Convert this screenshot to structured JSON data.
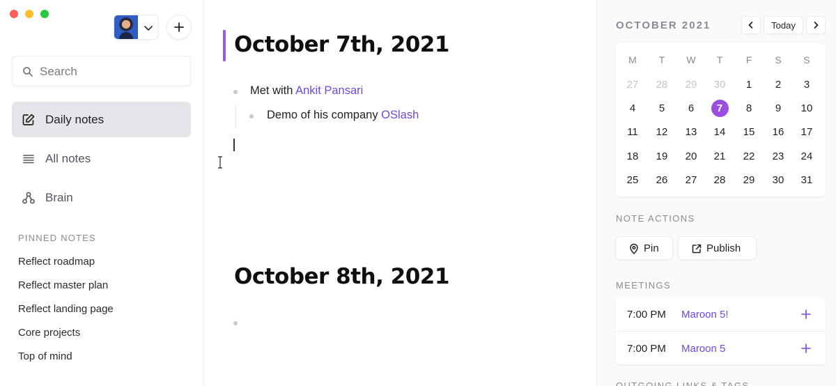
{
  "sidebar": {
    "search_placeholder": "Search",
    "nav": [
      {
        "label": "Daily notes",
        "icon": "edit-icon",
        "active": true
      },
      {
        "label": "All notes",
        "icon": "list-icon",
        "active": false
      },
      {
        "label": "Brain",
        "icon": "graph-icon",
        "active": false
      }
    ],
    "pinned_heading": "PINNED NOTES",
    "pinned": [
      "Reflect roadmap",
      "Reflect master plan",
      "Reflect landing page",
      "Core projects",
      "Top of mind"
    ]
  },
  "main": {
    "days": [
      {
        "heading": "October 7th, 2021",
        "lines": [
          {
            "prefix": "Met with ",
            "link": "Ankit Pansari"
          },
          {
            "prefix": "Demo of his company ",
            "link": "OSlash"
          }
        ]
      },
      {
        "heading": "October 8th, 2021",
        "lines": []
      }
    ]
  },
  "calendar": {
    "month_title": "OCTOBER 2021",
    "today_label": "Today",
    "weekdays": [
      "M",
      "T",
      "W",
      "T",
      "F",
      "S",
      "S"
    ],
    "weeks": [
      [
        "27",
        "28",
        "29",
        "30",
        "1",
        "2",
        "3"
      ],
      [
        "4",
        "5",
        "6",
        "7",
        "8",
        "9",
        "10"
      ],
      [
        "11",
        "12",
        "13",
        "14",
        "15",
        "16",
        "17"
      ],
      [
        "18",
        "19",
        "20",
        "21",
        "22",
        "23",
        "24"
      ],
      [
        "25",
        "26",
        "27",
        "28",
        "29",
        "30",
        "31"
      ]
    ],
    "selected_day": "7",
    "accent_color": "#9b4fe0"
  },
  "note_actions": {
    "title": "NOTE ACTIONS",
    "pin_label": "Pin",
    "publish_label": "Publish"
  },
  "meetings": {
    "title": "MEETINGS",
    "items": [
      {
        "time": "7:00 PM",
        "title": "Maroon 5!"
      },
      {
        "time": "7:00 PM",
        "title": "Maroon 5"
      }
    ]
  },
  "outgoing_title": "OUTGOING LINKS & TAGS"
}
